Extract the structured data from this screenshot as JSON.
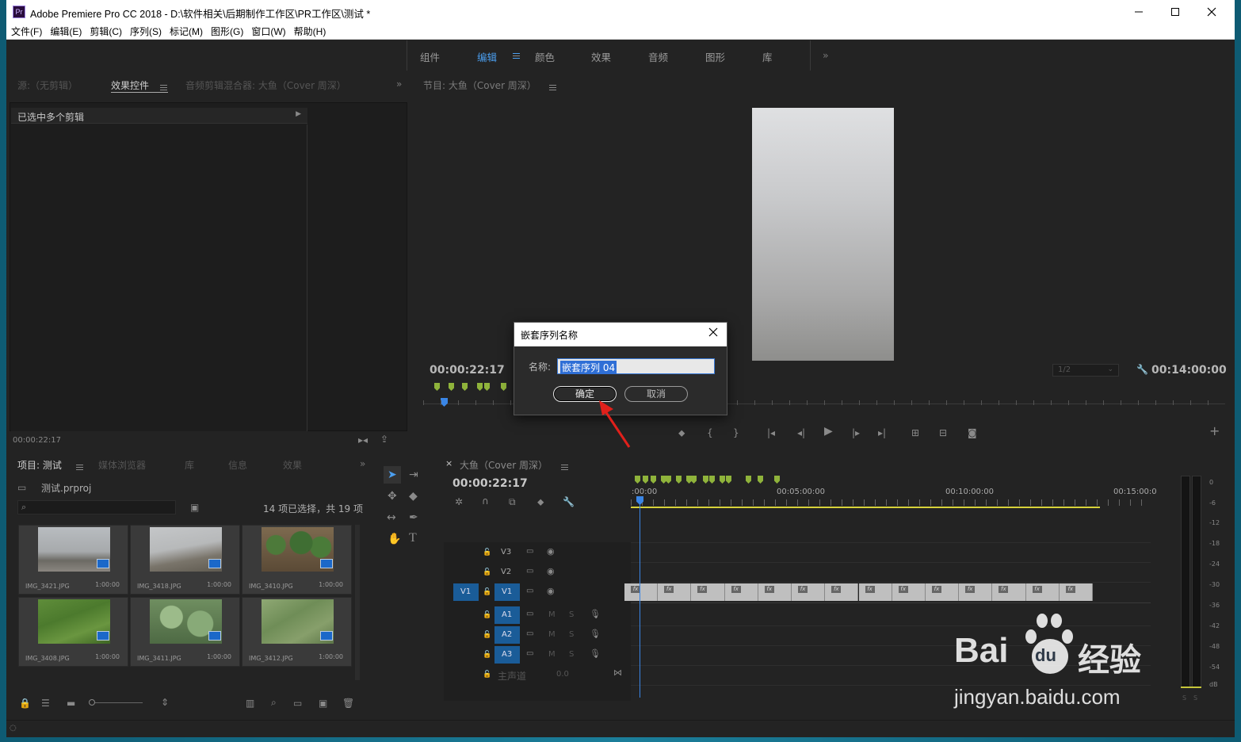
{
  "window": {
    "logo": "Pr",
    "title": "Adobe Premiere Pro CC 2018 - D:\\软件相关\\后期制作工作区\\PR工作区\\测试 *",
    "controls": [
      "minimize-icon",
      "maximize-icon",
      "close-icon"
    ]
  },
  "menu": [
    "文件(F)",
    "编辑(E)",
    "剪辑(C)",
    "序列(S)",
    "标记(M)",
    "图形(G)",
    "窗口(W)",
    "帮助(H)"
  ],
  "workspaces": {
    "items": [
      "组件",
      "编辑",
      "颜色",
      "效果",
      "音频",
      "图形",
      "库"
    ],
    "active": "编辑",
    "overflow": "»"
  },
  "source_panel": {
    "tabs": [
      "源:（无剪辑）",
      "效果控件",
      "音频剪辑混合器: 大鱼（Cover 周深）"
    ],
    "active_tab": "效果控件",
    "header_text": "已选中多个剪辑",
    "timecode": "00:00:22:17",
    "overflow": "»"
  },
  "program_monitor": {
    "title": "节目: 大鱼（Cover 周深）",
    "timecode_left": "00:00:22:17",
    "timecode_right": "00:14:00:00",
    "resolution": "1/2",
    "accent_color": "#4b9ff0"
  },
  "project_panel": {
    "tabs": [
      "项目: 测试",
      "媒体浏览器",
      "库",
      "信息",
      "效果"
    ],
    "active_tab": "项目: 测试",
    "project_file": "测试.prproj",
    "selection_info": "14 项已选择，共 19 项",
    "items": [
      {
        "name": "IMG_3421.JPG",
        "duration": "1:00:00",
        "image": "foggy-river"
      },
      {
        "name": "IMG_3418.JPG",
        "duration": "1:00:00",
        "image": "river-bank"
      },
      {
        "name": "IMG_3410.JPG",
        "duration": "1:00:00",
        "image": "watermelons"
      },
      {
        "name": "IMG_3408.JPG",
        "duration": "1:00:00",
        "image": "green-grass"
      },
      {
        "name": "IMG_3411.JPG",
        "duration": "1:00:00",
        "image": "pumpkin-leaves"
      },
      {
        "name": "IMG_3412.JPG",
        "duration": "1:00:00",
        "image": "leaves-field"
      }
    ]
  },
  "timeline": {
    "sequence_name": "大鱼（Cover 周深）",
    "timecode": "00:00:22:17",
    "ruler": [
      ":00:00",
      "00:05:00:00",
      "00:10:00:00",
      "00:15:00:0"
    ],
    "video_tracks": [
      "V3",
      "V2",
      "V1"
    ],
    "source_patch": "V1",
    "audio_tracks": [
      "A1",
      "A2",
      "A3"
    ],
    "track_buttons": {
      "mute": "M",
      "solo": "S"
    },
    "master": {
      "label": "主声道",
      "value": "0.0"
    },
    "clip_count": 14,
    "clip_badge": "fx"
  },
  "vu_meter": {
    "scale": [
      "0",
      "-6",
      "-12",
      "-18",
      "-24",
      "-30",
      "-36",
      "-42",
      "-48",
      "-54",
      "dB"
    ],
    "buttons": [
      "S",
      "S"
    ]
  },
  "dialog": {
    "title": "嵌套序列名称",
    "name_label": "名称:",
    "name_value": "嵌套序列 04",
    "ok": "确定",
    "cancel": "取消"
  },
  "watermark": {
    "brand": "Bai",
    "paw": "du",
    "suffix": "经验",
    "url": "jingyan.baidu.com"
  }
}
